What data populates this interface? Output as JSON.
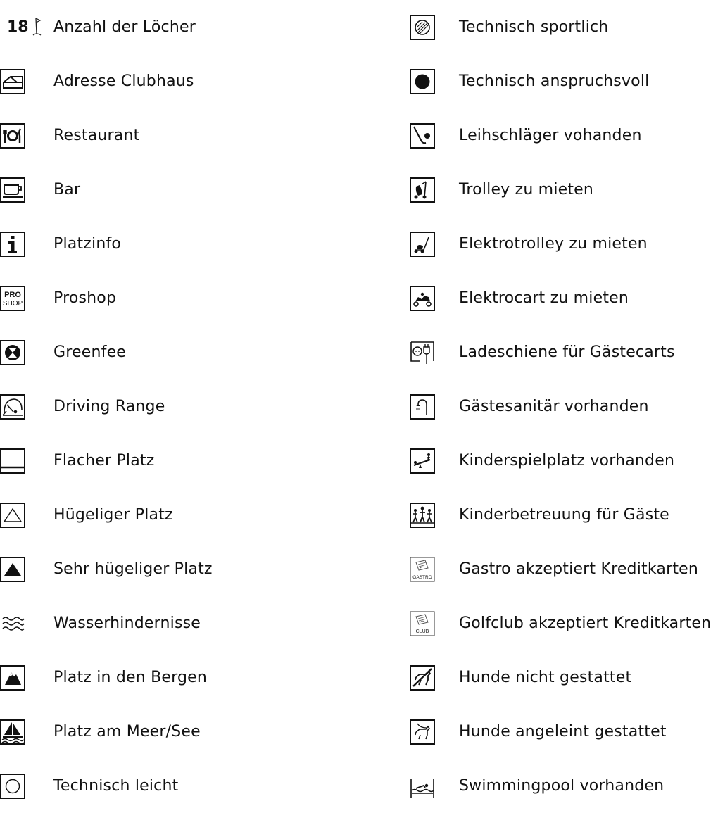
{
  "legend": {
    "left": [
      {
        "prefix": "18",
        "label": "Anzahl der Löcher",
        "icon": "golf-flag-icon"
      },
      {
        "label": "Adresse Clubhaus",
        "icon": "clubhouse-icon"
      },
      {
        "label": "Restaurant",
        "icon": "restaurant-icon"
      },
      {
        "label": "Bar",
        "icon": "bar-cup-icon"
      },
      {
        "label": "Platzinfo",
        "icon": "info-icon"
      },
      {
        "label": "Proshop",
        "icon": "proshop-icon",
        "icon_text_top": "PRO",
        "icon_text_bottom": "SHOP"
      },
      {
        "label": "Greenfee",
        "icon": "greenfee-icon"
      },
      {
        "label": "Driving Range",
        "icon": "driving-range-icon"
      },
      {
        "label": "Flacher Platz",
        "icon": "flat-course-icon"
      },
      {
        "label": "Hügeliger Platz",
        "icon": "hilly-course-icon"
      },
      {
        "label": "Sehr hügeliger Platz",
        "icon": "very-hilly-course-icon"
      },
      {
        "label": "Wasserhindernisse",
        "icon": "water-hazard-icon"
      },
      {
        "label": "Platz in den Bergen",
        "icon": "mountain-course-icon"
      },
      {
        "label": "Platz am Meer/See",
        "icon": "sea-lake-course-icon"
      },
      {
        "label": "Technisch leicht",
        "icon": "technically-easy-icon"
      }
    ],
    "right": [
      {
        "label": "Technisch sportlich",
        "icon": "technically-sporty-icon"
      },
      {
        "label": "Technisch anspruchsvoll",
        "icon": "technically-demanding-icon"
      },
      {
        "label": "Leihschläger vohanden",
        "icon": "rental-clubs-icon"
      },
      {
        "label": "Trolley zu mieten",
        "icon": "trolley-icon"
      },
      {
        "label": "Elektrotrolley zu mieten",
        "icon": "electric-trolley-icon"
      },
      {
        "label": "Elektrocart zu mieten",
        "icon": "electric-cart-icon"
      },
      {
        "label": "Ladeschiene für Gästecarts",
        "icon": "charging-icon"
      },
      {
        "label": "Gästesanitär vorhanden",
        "icon": "shower-icon"
      },
      {
        "label": "Kinderspielplatz vorhanden",
        "icon": "playground-icon"
      },
      {
        "label": "Kinderbetreuung für Gäste",
        "icon": "childcare-icon"
      },
      {
        "label": "Gastro akzeptiert Kreditkarten",
        "icon": "credit-card-gastro-icon",
        "icon_text": "GASTRO"
      },
      {
        "label": "Golfclub akzeptiert Kreditkarten",
        "icon": "credit-card-club-icon",
        "icon_text": "CLUB"
      },
      {
        "label": "Hunde nicht gestattet",
        "icon": "no-dogs-icon"
      },
      {
        "label": "Hunde angeleint gestattet",
        "icon": "dogs-leashed-icon"
      },
      {
        "label": "Swimmingpool vorhanden",
        "icon": "swimming-pool-icon"
      }
    ]
  }
}
